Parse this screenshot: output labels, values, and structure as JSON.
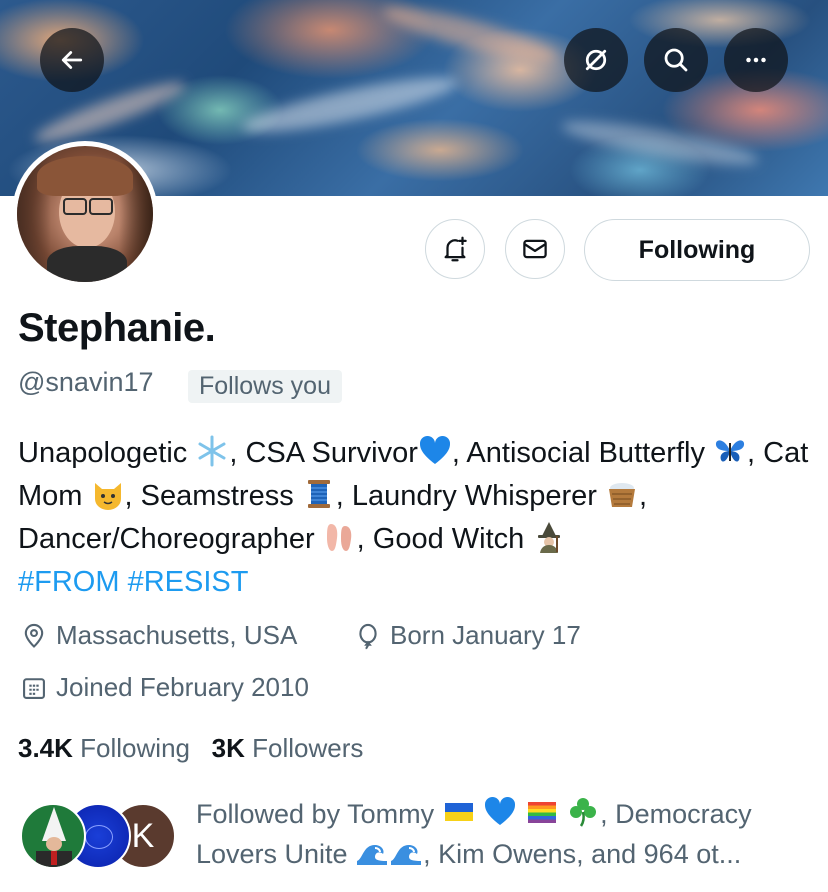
{
  "header": {
    "back_icon": "arrow-left-icon",
    "grok_icon": "grok-icon",
    "search_icon": "search-icon",
    "more_icon": "more-dots-icon"
  },
  "actions": {
    "notify_icon": "bell-plus-icon",
    "message_icon": "envelope-icon",
    "following_label": "Following"
  },
  "profile": {
    "display_name": "Stephanie.",
    "handle": "@snavin17",
    "follows_you": "Follows you",
    "bio": {
      "seg1": "Unapologetic ",
      "seg2": ", CSA Survivor",
      "seg3": ", Antisocial Butterfly ",
      "seg4": ", Cat Mom ",
      "seg5": ", Seamstress ",
      "seg6": ", Laundry Whisperer ",
      "seg7": ", Dancer/Choreographer ",
      "seg8": ", Good Witch ",
      "hashtag1": "#FROM",
      "hashtag2": "#RESIST"
    },
    "location": "Massachusetts, USA",
    "birthday": "Born January 17",
    "joined": "Joined February 2010"
  },
  "stats": {
    "following_count": "3.4K",
    "following_label": "Following",
    "followers_count": "3K",
    "followers_label": "Followers"
  },
  "followed_by": {
    "part1": "Followed by Tommy ",
    "part2": ", Democracy Lovers Unite ",
    "part3": ", Kim Owens, and 964 ot...",
    "avatar3_letter": "K"
  },
  "colors": {
    "link": "#1d9bf0",
    "secondary_text": "#536471",
    "primary_text": "#0f1419",
    "border": "#cfd9de"
  }
}
